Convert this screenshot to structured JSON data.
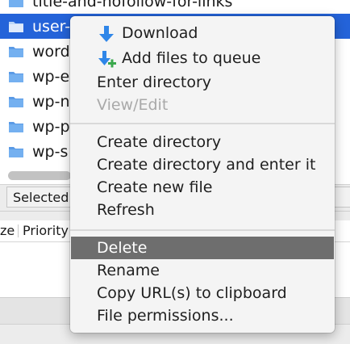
{
  "file_list": {
    "rows": [
      {
        "name": "title-and-nofollow-for-links",
        "selected": false
      },
      {
        "name": "user-",
        "selected": true
      },
      {
        "name": "word",
        "selected": false
      },
      {
        "name": "wp-e",
        "selected": false
      },
      {
        "name": "wp-n",
        "selected": false
      },
      {
        "name": "wp-p",
        "selected": false
      },
      {
        "name": "wp-s",
        "selected": false
      }
    ]
  },
  "status": {
    "selected_text": "Selected"
  },
  "queue": {
    "columns": [
      "ze",
      "Priority"
    ]
  },
  "context_menu": {
    "items": {
      "download": "Download",
      "add_to_queue": "Add files to queue",
      "enter_directory": "Enter directory",
      "view_edit": "View/Edit",
      "create_directory": "Create directory",
      "create_directory_enter": "Create directory and enter it",
      "create_file": "Create new file",
      "refresh": "Refresh",
      "delete": "Delete",
      "rename": "Rename",
      "copy_url": "Copy URL(s) to clipboard",
      "file_permissions": "File permissions..."
    },
    "icons": {
      "download": "download-arrow-icon",
      "add_to_queue": "add-to-queue-icon"
    },
    "highlighted": "delete"
  },
  "colors": {
    "selection": "#2463d9",
    "menu_highlight": "#6e6e6e",
    "disabled_text": "#a9a9a9",
    "folder": "#5a9ae6",
    "download_arrow": "#2f86e8",
    "queue_plus": "#3aa84c"
  }
}
